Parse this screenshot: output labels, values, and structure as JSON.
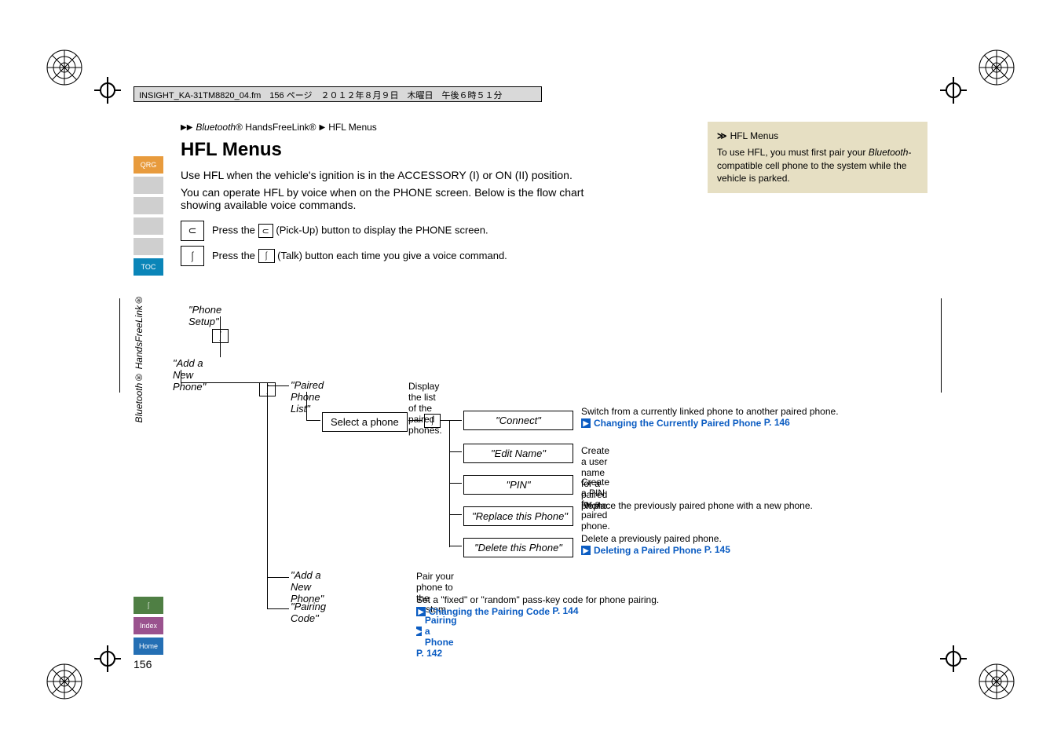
{
  "header_text": "INSIGHT_KA-31TM8820_04.fm　156 ページ　２０１２年８月９日　木曜日　午後６時５１分",
  "breadcrumb": {
    "a": "Bluetooth",
    "a_suffix": "® HandsFreeLink®",
    "b": "HFL Menus"
  },
  "title": "HFL Menus",
  "intro1": "Use HFL when the vehicle's ignition is in the ACCESSORY (I) or ON (II) position.",
  "intro2": "You can operate HFL by voice when on the PHONE screen. Below is the flow chart showing available voice commands.",
  "step1_pre": "Press the ",
  "step1_post": " (Pick-Up) button to display the PHONE screen.",
  "step2_pre": "Press the ",
  "step2_post": " (Talk) button each time you give a voice command.",
  "pickup_glyph": "⊂",
  "talk_glyph": "⎰",
  "callout": {
    "title_glyph": "≫",
    "title": "HFL Menus",
    "body_pre": "To use HFL, you must first pair your ",
    "body_em": "Bluetooth",
    "body_post": "-compatible cell phone to the system while the vehicle is parked."
  },
  "tabs": {
    "qrg": "QRG",
    "toc": "TOC",
    "voice": "",
    "index": "Index",
    "home": "Home"
  },
  "vertical_chapter": "Bluetooth® HandsFreeLink®",
  "page_number": "156",
  "flow": {
    "phone_setup": "\"Phone Setup\"",
    "add_new_phone": "\"Add a New Phone\"",
    "paired_list": "\"Paired Phone List\"",
    "paired_list_desc": "Display the list of the paired phones.",
    "select_phone": "Select a phone",
    "connect": "\"Connect\"",
    "connect_desc_pre": "Switch from a currently linked phone to another paired phone. ",
    "connect_link": "Changing the Currently Paired Phone",
    "connect_page": "P. 146",
    "edit_name": "\"Edit Name\"",
    "edit_name_desc": "Create a user name for a paired phone.",
    "pin": "\"PIN\"",
    "pin_desc": "Create a PIN for a paired phone.",
    "replace": "\"Replace this Phone\"",
    "replace_desc": "Replace the previously paired phone with a new phone.",
    "delete": "\"Delete this Phone\"",
    "delete_desc_pre": "Delete a previously paired phone.",
    "delete_link": "Deleting a Paired Phone",
    "delete_page": "P. 145",
    "add_new_phone2": "\"Add a New Phone\"",
    "add_new_desc_pre": "Pair your phone to the system. ",
    "add_new_link": "Pairing a Phone",
    "add_new_page": "P. 142",
    "pairing_code": "\"Pairing Code\"",
    "pairing_desc_pre": "Set a \"fixed\" or \"random\" pass-key code for phone pairing.",
    "pairing_link": "Changing the Pairing Code",
    "pairing_page": "P. 144"
  }
}
